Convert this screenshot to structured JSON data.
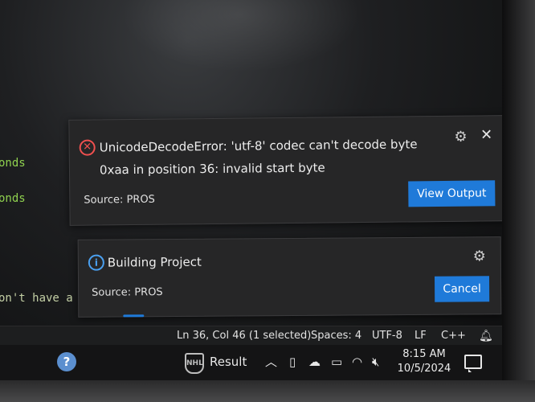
{
  "editor": {
    "fragments": [
      "onds",
      "onds",
      "on't have a so"
    ]
  },
  "error_notification": {
    "icon": "error-circle-icon",
    "message": "UnicodeDecodeError: 'utf-8' codec can't decode byte 0xaa in position 36: invalid start byte",
    "source": "Source: PROS",
    "action_label": "View Output",
    "gear_icon": "gear-icon",
    "close_icon": "close-icon",
    "accent": "#f0504f"
  },
  "info_notification": {
    "icon": "info-circle-icon",
    "title": "Building Project",
    "source": "Source: PROS",
    "action_label": "Cancel",
    "gear_icon": "gear-icon",
    "accent": "#4aa0f0"
  },
  "status_bar": {
    "cursor": "Ln 36, Col 46 (1 selected)",
    "spaces": "Spaces: 4",
    "encoding": "UTF-8",
    "eol": "LF",
    "language": "C++",
    "bell_icon": "bell-icon"
  },
  "taskbar": {
    "help_icon": "help-icon",
    "nhl_icon": "nhl-logo-icon",
    "result_label": "Result",
    "time": "8:15 AM",
    "date": "10/5/2024",
    "tray_icons": [
      "chevron-up-icon",
      "phone-link-icon",
      "cloud-icon",
      "battery-icon",
      "wifi-icon",
      "volume-muted-icon"
    ],
    "notification_icon": "notification-icon"
  },
  "colors": {
    "button_blue": "#1f7ad9",
    "toast_bg": "#262627"
  }
}
